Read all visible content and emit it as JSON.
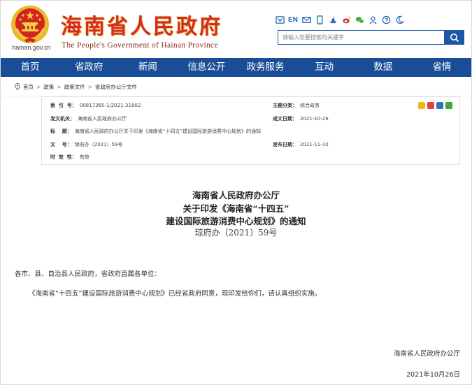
{
  "header": {
    "site_title": "海南省人民政府",
    "site_subtitle": "The People's Government  of  Hainan Province",
    "site_domain": "hainan.gov.cn",
    "language_label": "EN",
    "search_placeholder": "请输入您要搜索的关键字",
    "toolbar_icons": [
      "accessibility-icon",
      "en-language",
      "mail-icon",
      "mobile-icon",
      "ship-icon",
      "weibo-icon",
      "wechat-icon",
      "user-icon",
      "help-icon",
      "moon-icon"
    ]
  },
  "nav": {
    "items": [
      "首页",
      "省政府",
      "新闻",
      "信息公开",
      "政务服务",
      "互动",
      "数据",
      "省情"
    ]
  },
  "breadcrumb": {
    "items": [
      "首页",
      "政策",
      "政策文件",
      "省政府办公厅文件"
    ]
  },
  "meta": {
    "index_label": "索  引  号：",
    "index_value": "00817365-1/2021-31802",
    "issuer_label": "发文机关：",
    "issuer_value": "海南省人民政府办公厅",
    "title_label": "标    题：",
    "title_value": "海南省人民政府办公厅关于印发《海南省“十四五”建设国际旅游消费中心规划》的通知",
    "docno_label": "文    号：",
    "docno_value": "琼府办（2021）59号",
    "validity_label": "时  效  性：",
    "validity_value": "有效",
    "category_label": "主题分类：",
    "category_value": "综合政务",
    "created_label": "成文日期：",
    "created_value": "2021-10-26",
    "published_label": "发布日期：",
    "published_value": "2021-11-10"
  },
  "article": {
    "title_line1": "海南省人民政府办公厅",
    "title_line2": "关于印发《海南省“十四五”",
    "title_line3": "建设国际旅游消费中心规划》的通知",
    "doc_number": "琼府办〔2021〕59号",
    "salutation": "各市、县、自治县人民政府，省政府直属各单位：",
    "body": "《海南省“十四五”建设国际旅游消费中心规划》已经省政府同意，现印发给你们，请认真组织实施。",
    "sign_org": "海南省人民政府办公厅",
    "sign_date": "2021年10月26日"
  },
  "colors": {
    "nav_bg": "#1a4d98",
    "title_red": "#d42a2a",
    "search_blue": "#1b57a6"
  }
}
